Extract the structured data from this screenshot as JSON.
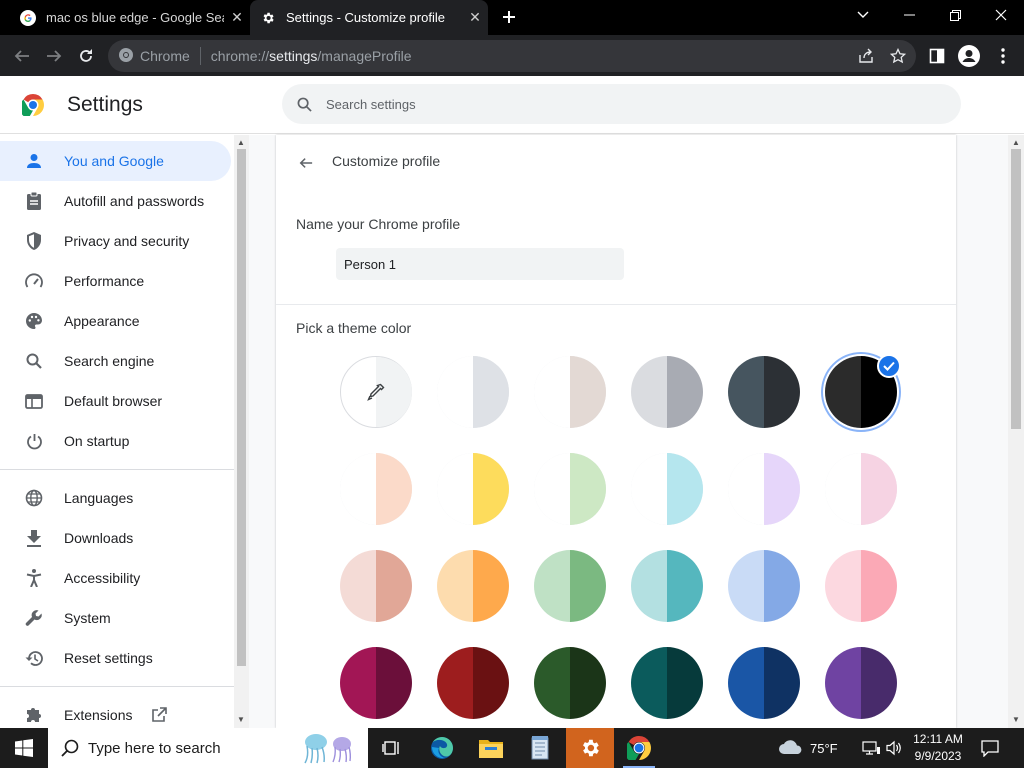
{
  "browser": {
    "tabs": [
      {
        "title": "mac os blue edge - Google Search",
        "active": false
      },
      {
        "title": "Settings - Customize profile",
        "active": true
      }
    ],
    "omnibox": {
      "chip_label": "Chrome",
      "url_scheme": "chrome://",
      "url_host": "settings",
      "url_path": "/manageProfile"
    }
  },
  "settings": {
    "title": "Settings",
    "search_placeholder": "Search settings",
    "nav": {
      "items": [
        {
          "label": "You and Google",
          "icon": "person-icon",
          "active": true
        },
        {
          "label": "Autofill and passwords",
          "icon": "clipboard-icon"
        },
        {
          "label": "Privacy and security",
          "icon": "shield-icon"
        },
        {
          "label": "Performance",
          "icon": "speedometer-icon"
        },
        {
          "label": "Appearance",
          "icon": "palette-icon"
        },
        {
          "label": "Search engine",
          "icon": "search-icon"
        },
        {
          "label": "Default browser",
          "icon": "browser-window-icon"
        },
        {
          "label": "On startup",
          "icon": "power-icon"
        },
        {
          "label": "Languages",
          "icon": "globe-icon"
        },
        {
          "label": "Downloads",
          "icon": "download-icon"
        },
        {
          "label": "Accessibility",
          "icon": "accessibility-icon"
        },
        {
          "label": "System",
          "icon": "wrench-icon"
        },
        {
          "label": "Reset settings",
          "icon": "reset-history-icon"
        },
        {
          "label": "Extensions",
          "icon": "puzzle-icon"
        }
      ]
    }
  },
  "customize_profile": {
    "title": "Customize profile",
    "name_label": "Name your Chrome profile",
    "name_value": "Person 1",
    "theme_label": "Pick a theme color",
    "selected_theme_index": 5,
    "swatches": [
      {
        "kind": "picker"
      },
      {
        "left": "#ffffff",
        "right": "#dee1e6"
      },
      {
        "left": "#ffffff",
        "right": "#e3d9d4"
      },
      {
        "left": "#dadce0",
        "right": "#a8abb3"
      },
      {
        "left": "#46555f",
        "right": "#2c3035"
      },
      {
        "left": "#2b2b2b",
        "right": "#000000"
      },
      {
        "left": "#ffffff",
        "right": "#fbdac9"
      },
      {
        "left": "#ffffff",
        "right": "#fddc5c"
      },
      {
        "left": "#ffffff",
        "right": "#cde8c4"
      },
      {
        "left": "#ffffff",
        "right": "#b5e6ee"
      },
      {
        "left": "#ffffff",
        "right": "#e6d6fa"
      },
      {
        "left": "#ffffff",
        "right": "#f6d3e3"
      },
      {
        "left": "#f4dbd6",
        "right": "#e1a797"
      },
      {
        "left": "#fddcae",
        "right": "#fea94c"
      },
      {
        "left": "#bfe1c5",
        "right": "#7bb981"
      },
      {
        "left": "#b3e0e1",
        "right": "#55b7be"
      },
      {
        "left": "#c9dbf6",
        "right": "#84a9e6"
      },
      {
        "left": "#fcd8e0",
        "right": "#fba9b6"
      },
      {
        "left": "#a21655",
        "right": "#6b0f3a"
      },
      {
        "left": "#9d1d1e",
        "right": "#6a1112"
      },
      {
        "left": "#2b5a2a",
        "right": "#1b3518"
      },
      {
        "left": "#0b5b5c",
        "right": "#063a3b"
      },
      {
        "left": "#1a56a6",
        "right": "#0f3263"
      },
      {
        "left": "#6f43a2",
        "right": "#482b6b"
      }
    ]
  },
  "taskbar": {
    "search_placeholder": "Type here to search",
    "weather": "75°F",
    "time": "12:11 AM",
    "date": "9/9/2023"
  },
  "colors": {
    "accent": "#1a73e8",
    "active_nav_bg": "#e8f0fe",
    "chrome_dark": "#202124"
  }
}
